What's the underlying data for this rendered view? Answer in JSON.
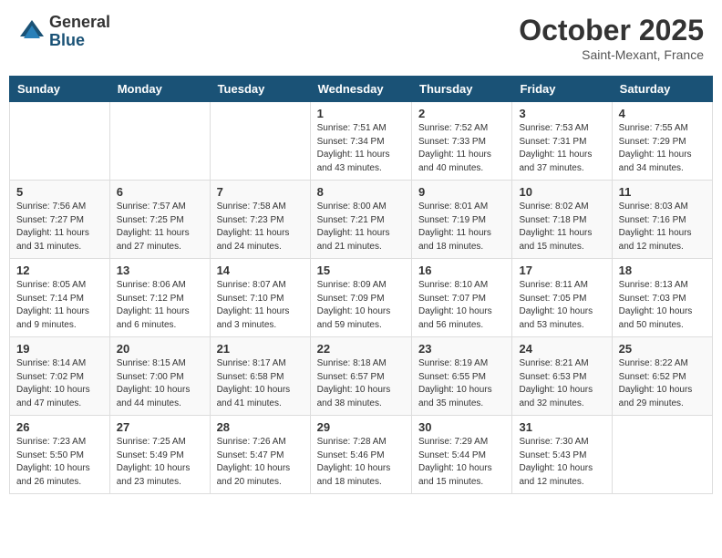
{
  "header": {
    "logo_general": "General",
    "logo_blue": "Blue",
    "month": "October 2025",
    "location": "Saint-Mexant, France"
  },
  "days_of_week": [
    "Sunday",
    "Monday",
    "Tuesday",
    "Wednesday",
    "Thursday",
    "Friday",
    "Saturday"
  ],
  "weeks": [
    [
      {
        "day": "",
        "info": ""
      },
      {
        "day": "",
        "info": ""
      },
      {
        "day": "",
        "info": ""
      },
      {
        "day": "1",
        "info": "Sunrise: 7:51 AM\nSunset: 7:34 PM\nDaylight: 11 hours\nand 43 minutes."
      },
      {
        "day": "2",
        "info": "Sunrise: 7:52 AM\nSunset: 7:33 PM\nDaylight: 11 hours\nand 40 minutes."
      },
      {
        "day": "3",
        "info": "Sunrise: 7:53 AM\nSunset: 7:31 PM\nDaylight: 11 hours\nand 37 minutes."
      },
      {
        "day": "4",
        "info": "Sunrise: 7:55 AM\nSunset: 7:29 PM\nDaylight: 11 hours\nand 34 minutes."
      }
    ],
    [
      {
        "day": "5",
        "info": "Sunrise: 7:56 AM\nSunset: 7:27 PM\nDaylight: 11 hours\nand 31 minutes."
      },
      {
        "day": "6",
        "info": "Sunrise: 7:57 AM\nSunset: 7:25 PM\nDaylight: 11 hours\nand 27 minutes."
      },
      {
        "day": "7",
        "info": "Sunrise: 7:58 AM\nSunset: 7:23 PM\nDaylight: 11 hours\nand 24 minutes."
      },
      {
        "day": "8",
        "info": "Sunrise: 8:00 AM\nSunset: 7:21 PM\nDaylight: 11 hours\nand 21 minutes."
      },
      {
        "day": "9",
        "info": "Sunrise: 8:01 AM\nSunset: 7:19 PM\nDaylight: 11 hours\nand 18 minutes."
      },
      {
        "day": "10",
        "info": "Sunrise: 8:02 AM\nSunset: 7:18 PM\nDaylight: 11 hours\nand 15 minutes."
      },
      {
        "day": "11",
        "info": "Sunrise: 8:03 AM\nSunset: 7:16 PM\nDaylight: 11 hours\nand 12 minutes."
      }
    ],
    [
      {
        "day": "12",
        "info": "Sunrise: 8:05 AM\nSunset: 7:14 PM\nDaylight: 11 hours\nand 9 minutes."
      },
      {
        "day": "13",
        "info": "Sunrise: 8:06 AM\nSunset: 7:12 PM\nDaylight: 11 hours\nand 6 minutes."
      },
      {
        "day": "14",
        "info": "Sunrise: 8:07 AM\nSunset: 7:10 PM\nDaylight: 11 hours\nand 3 minutes."
      },
      {
        "day": "15",
        "info": "Sunrise: 8:09 AM\nSunset: 7:09 PM\nDaylight: 10 hours\nand 59 minutes."
      },
      {
        "day": "16",
        "info": "Sunrise: 8:10 AM\nSunset: 7:07 PM\nDaylight: 10 hours\nand 56 minutes."
      },
      {
        "day": "17",
        "info": "Sunrise: 8:11 AM\nSunset: 7:05 PM\nDaylight: 10 hours\nand 53 minutes."
      },
      {
        "day": "18",
        "info": "Sunrise: 8:13 AM\nSunset: 7:03 PM\nDaylight: 10 hours\nand 50 minutes."
      }
    ],
    [
      {
        "day": "19",
        "info": "Sunrise: 8:14 AM\nSunset: 7:02 PM\nDaylight: 10 hours\nand 47 minutes."
      },
      {
        "day": "20",
        "info": "Sunrise: 8:15 AM\nSunset: 7:00 PM\nDaylight: 10 hours\nand 44 minutes."
      },
      {
        "day": "21",
        "info": "Sunrise: 8:17 AM\nSunset: 6:58 PM\nDaylight: 10 hours\nand 41 minutes."
      },
      {
        "day": "22",
        "info": "Sunrise: 8:18 AM\nSunset: 6:57 PM\nDaylight: 10 hours\nand 38 minutes."
      },
      {
        "day": "23",
        "info": "Sunrise: 8:19 AM\nSunset: 6:55 PM\nDaylight: 10 hours\nand 35 minutes."
      },
      {
        "day": "24",
        "info": "Sunrise: 8:21 AM\nSunset: 6:53 PM\nDaylight: 10 hours\nand 32 minutes."
      },
      {
        "day": "25",
        "info": "Sunrise: 8:22 AM\nSunset: 6:52 PM\nDaylight: 10 hours\nand 29 minutes."
      }
    ],
    [
      {
        "day": "26",
        "info": "Sunrise: 7:23 AM\nSunset: 5:50 PM\nDaylight: 10 hours\nand 26 minutes."
      },
      {
        "day": "27",
        "info": "Sunrise: 7:25 AM\nSunset: 5:49 PM\nDaylight: 10 hours\nand 23 minutes."
      },
      {
        "day": "28",
        "info": "Sunrise: 7:26 AM\nSunset: 5:47 PM\nDaylight: 10 hours\nand 20 minutes."
      },
      {
        "day": "29",
        "info": "Sunrise: 7:28 AM\nSunset: 5:46 PM\nDaylight: 10 hours\nand 18 minutes."
      },
      {
        "day": "30",
        "info": "Sunrise: 7:29 AM\nSunset: 5:44 PM\nDaylight: 10 hours\nand 15 minutes."
      },
      {
        "day": "31",
        "info": "Sunrise: 7:30 AM\nSunset: 5:43 PM\nDaylight: 10 hours\nand 12 minutes."
      },
      {
        "day": "",
        "info": ""
      }
    ]
  ]
}
